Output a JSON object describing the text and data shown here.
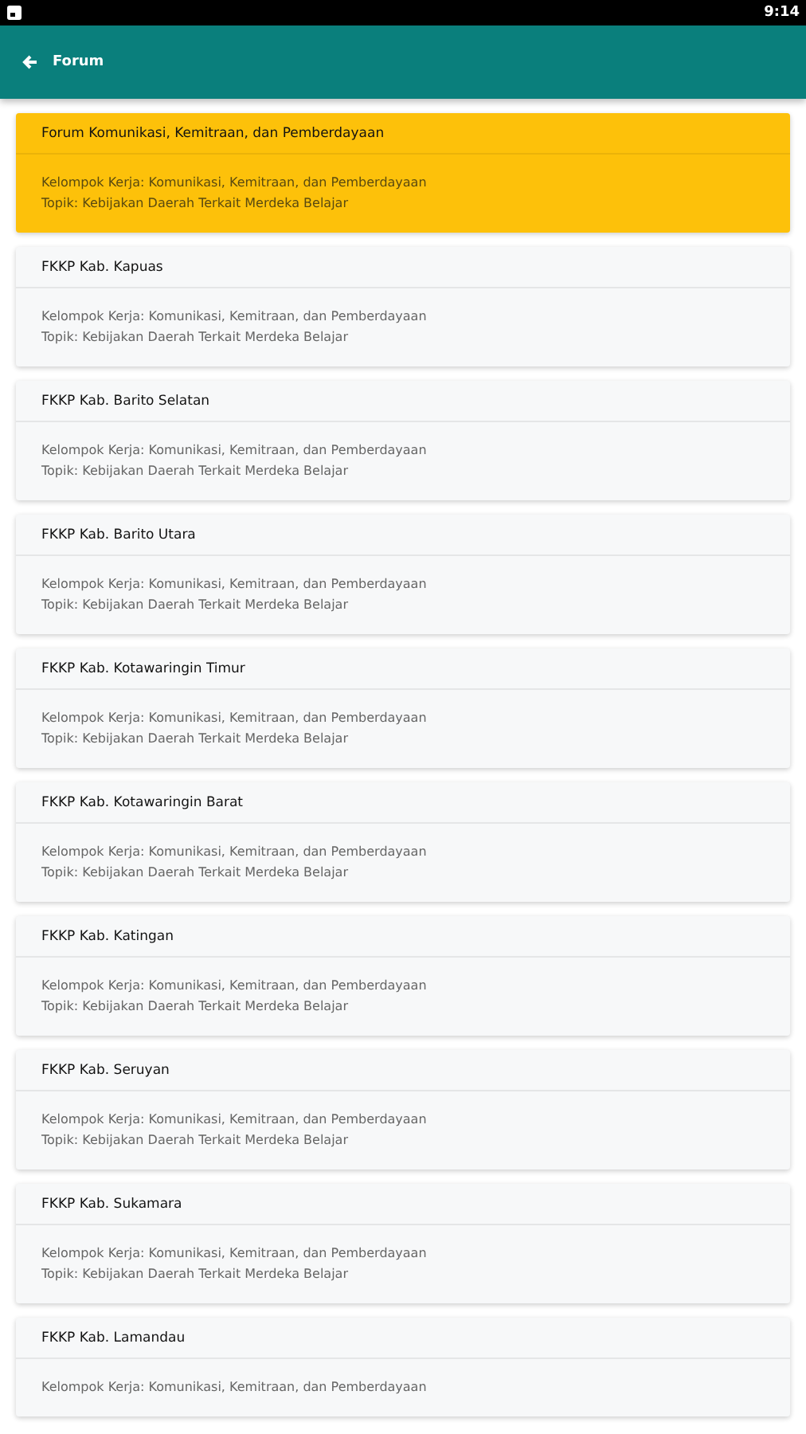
{
  "status_bar": {
    "time": "9:14"
  },
  "app_bar": {
    "title": "Forum"
  },
  "cards": [
    {
      "title": "Forum Komunikasi, Kemitraan, dan Pemberdayaan",
      "selected": true,
      "lines": [
        "Kelompok Kerja: Komunikasi, Kemitraan, dan Pemberdayaan",
        "Topik: Kebijakan Daerah Terkait Merdeka Belajar"
      ]
    },
    {
      "title": "FKKP Kab. Kapuas",
      "selected": false,
      "lines": [
        "Kelompok Kerja: Komunikasi, Kemitraan, dan Pemberdayaan",
        "Topik: Kebijakan Daerah Terkait Merdeka Belajar"
      ]
    },
    {
      "title": "FKKP Kab. Barito Selatan",
      "selected": false,
      "lines": [
        "Kelompok Kerja: Komunikasi, Kemitraan, dan Pemberdayaan",
        "Topik: Kebijakan Daerah Terkait Merdeka Belajar"
      ]
    },
    {
      "title": "FKKP Kab. Barito Utara",
      "selected": false,
      "lines": [
        "Kelompok Kerja: Komunikasi, Kemitraan, dan Pemberdayaan",
        "Topik: Kebijakan Daerah Terkait Merdeka Belajar"
      ]
    },
    {
      "title": "FKKP Kab. Kotawaringin Timur",
      "selected": false,
      "lines": [
        "Kelompok Kerja: Komunikasi, Kemitraan, dan Pemberdayaan",
        "Topik: Kebijakan Daerah Terkait Merdeka Belajar"
      ]
    },
    {
      "title": "FKKP Kab. Kotawaringin Barat",
      "selected": false,
      "lines": [
        "Kelompok Kerja: Komunikasi, Kemitraan, dan Pemberdayaan",
        "Topik: Kebijakan Daerah Terkait Merdeka Belajar"
      ]
    },
    {
      "title": "FKKP Kab. Katingan",
      "selected": false,
      "lines": [
        "Kelompok Kerja: Komunikasi, Kemitraan, dan Pemberdayaan",
        "Topik: Kebijakan Daerah Terkait Merdeka Belajar"
      ]
    },
    {
      "title": "FKKP Kab. Seruyan",
      "selected": false,
      "lines": [
        "Kelompok Kerja: Komunikasi, Kemitraan, dan Pemberdayaan",
        "Topik: Kebijakan Daerah Terkait Merdeka Belajar"
      ]
    },
    {
      "title": "FKKP Kab. Sukamara",
      "selected": false,
      "lines": [
        "Kelompok Kerja: Komunikasi, Kemitraan, dan Pemberdayaan",
        "Topik: Kebijakan Daerah Terkait Merdeka Belajar"
      ]
    },
    {
      "title": "FKKP Kab. Lamandau",
      "selected": false,
      "lines": [
        "Kelompok Kerja: Komunikasi, Kemitraan, dan Pemberdayaan"
      ]
    }
  ]
}
